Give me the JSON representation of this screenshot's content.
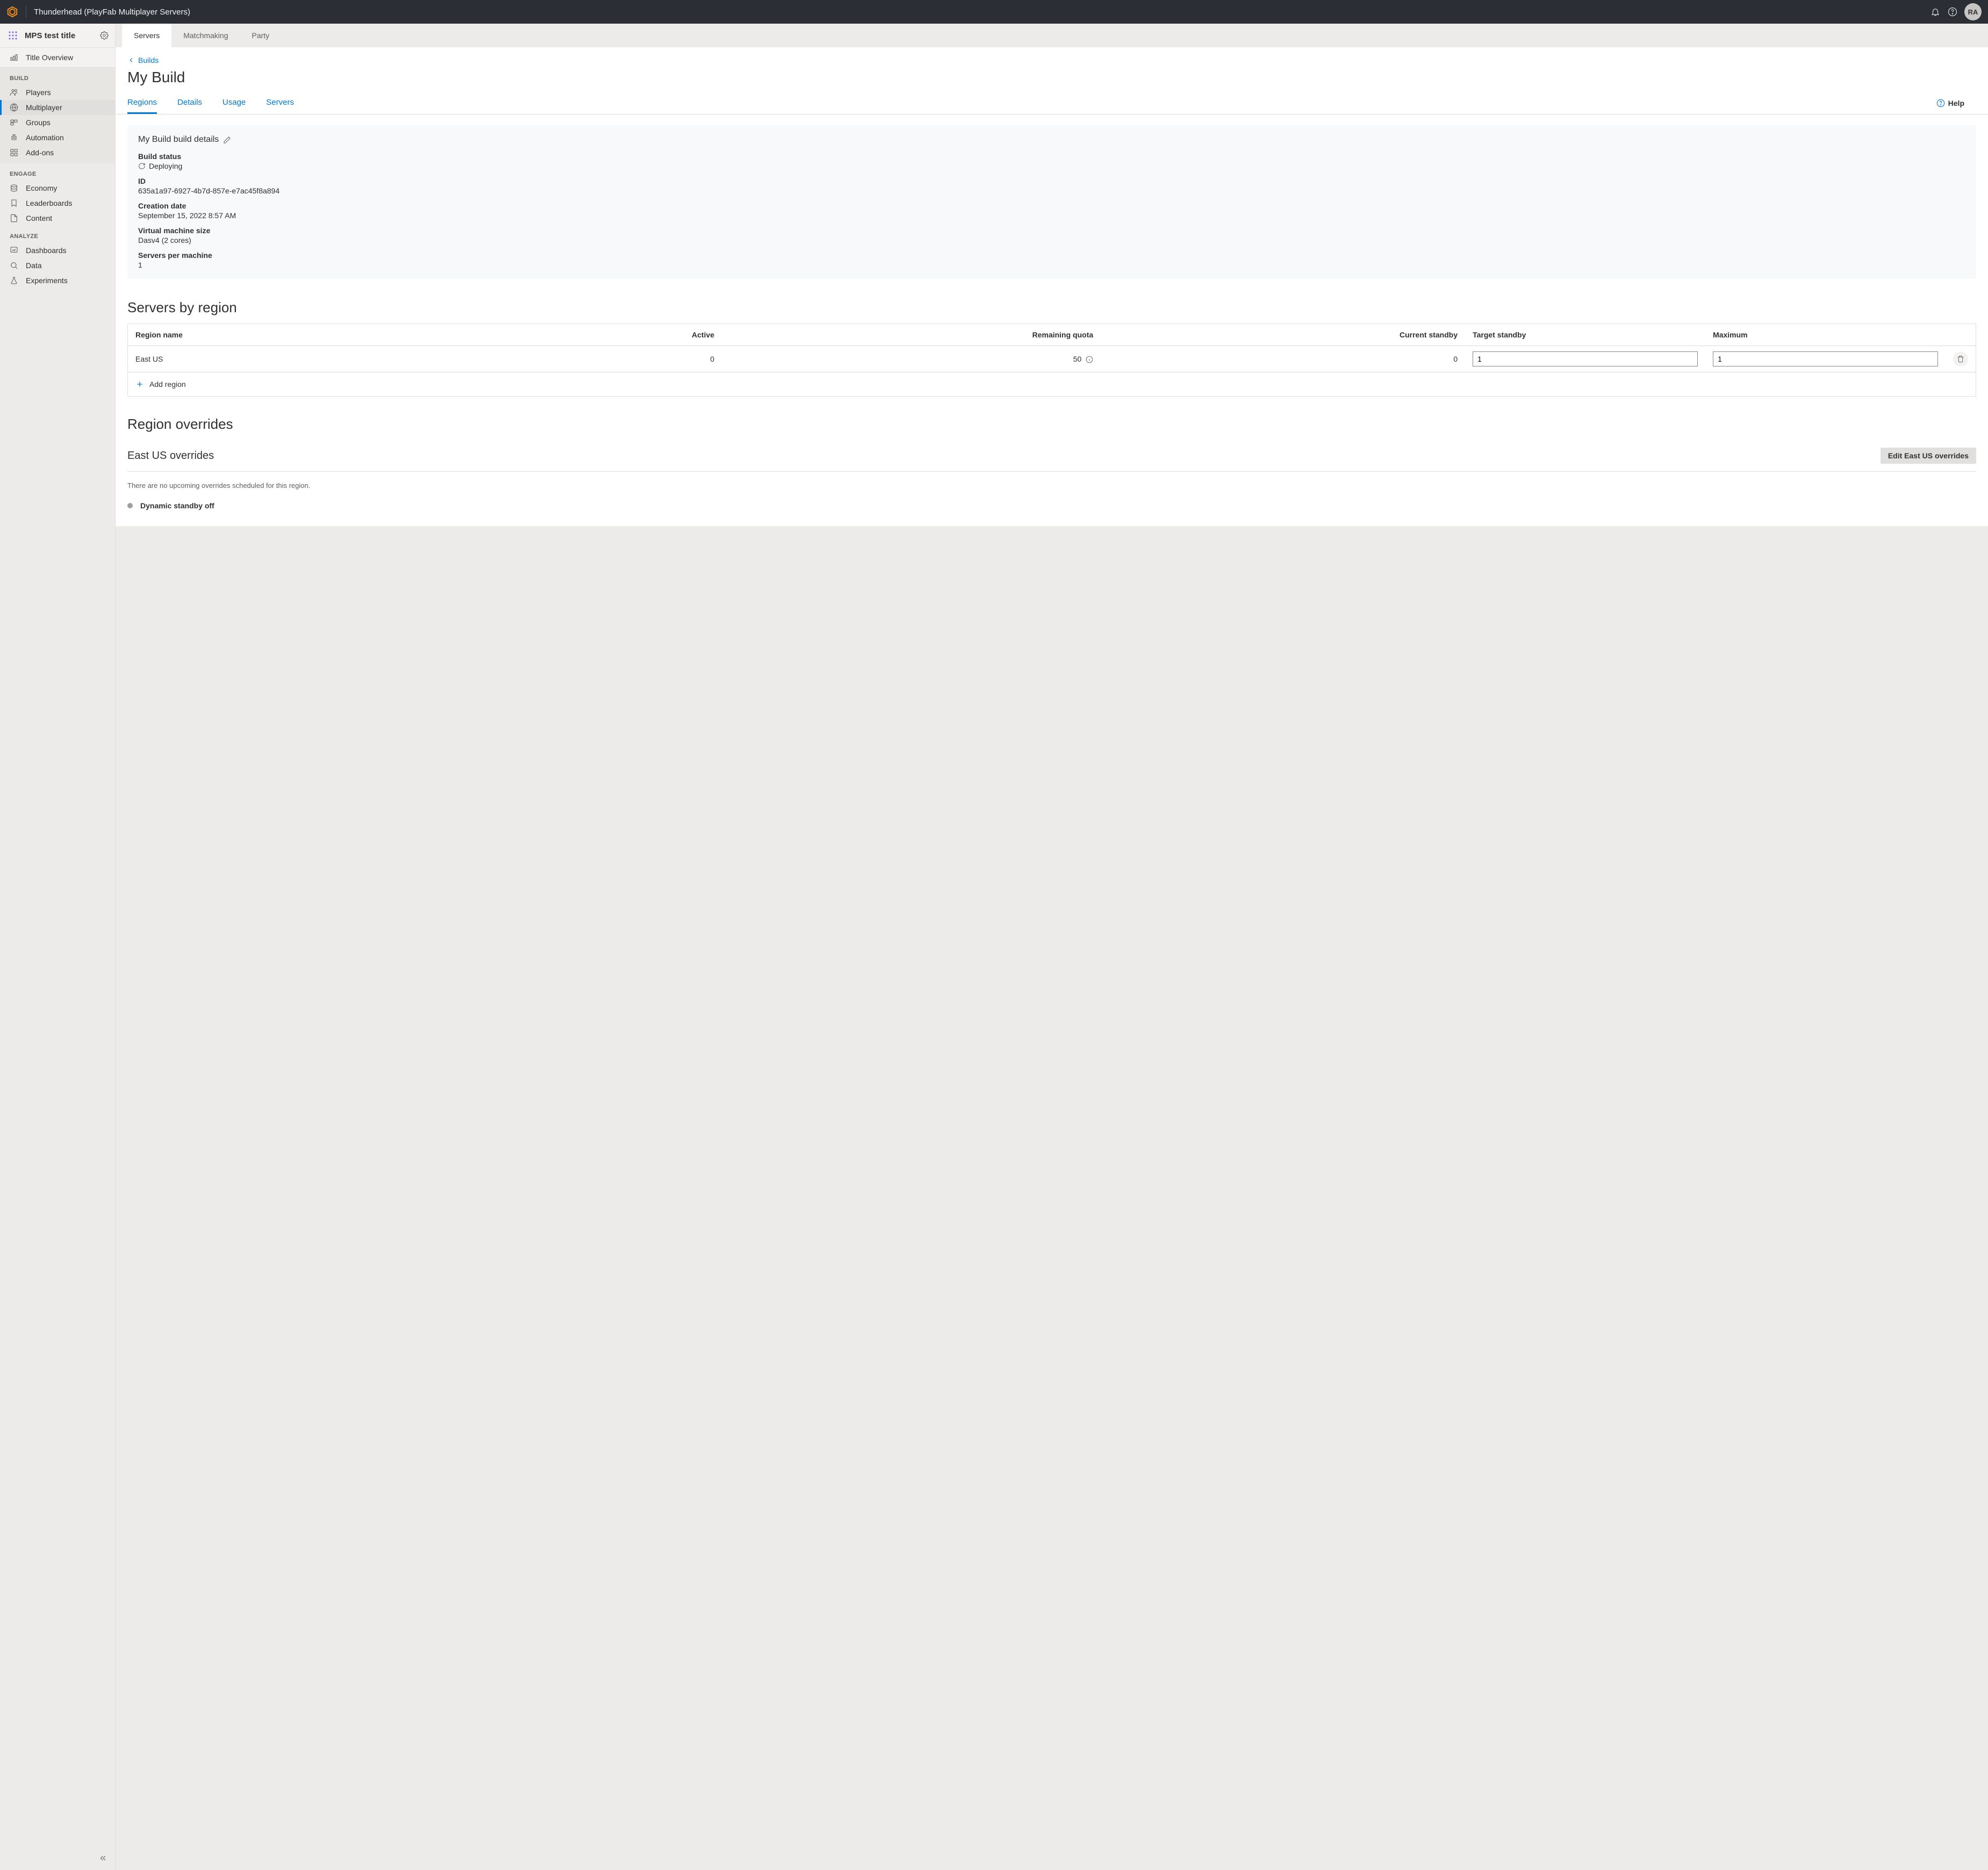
{
  "topbar": {
    "title": "Thunderhead (PlayFab Multiplayer Servers)",
    "avatar_initials": "RA"
  },
  "sidebar": {
    "title": "MPS test title",
    "overview_label": "Title Overview",
    "group_build": "BUILD",
    "build_items": {
      "players": "Players",
      "multiplayer": "Multiplayer",
      "groups": "Groups",
      "automation": "Automation",
      "addons": "Add-ons"
    },
    "group_engage": "ENGAGE",
    "engage_items": {
      "economy": "Economy",
      "leaderboards": "Leaderboards",
      "content": "Content"
    },
    "group_analyze": "ANALYZE",
    "analyze_items": {
      "dashboards": "Dashboards",
      "data": "Data",
      "experiments": "Experiments"
    }
  },
  "main_tabs": {
    "servers": "Servers",
    "matchmaking": "Matchmaking",
    "party": "Party"
  },
  "breadcrumb": {
    "label": "Builds"
  },
  "page_title": "My Build",
  "subtabs": {
    "regions": "Regions",
    "details": "Details",
    "usage": "Usage",
    "servers": "Servers"
  },
  "help_label": "Help",
  "build_details": {
    "heading": "My Build build details",
    "status_label": "Build status",
    "status_value": "Deploying",
    "id_label": "ID",
    "id_value": "635a1a97-6927-4b7d-857e-e7ac45f8a894",
    "created_label": "Creation date",
    "created_value": "September 15, 2022 8:57 AM",
    "vm_label": "Virtual machine size",
    "vm_value": "Dasv4 (2 cores)",
    "spm_label": "Servers per machine",
    "spm_value": "1"
  },
  "servers_by_region": {
    "heading": "Servers by region",
    "columns": {
      "region": "Region name",
      "active": "Active",
      "remaining_quota": "Remaining quota",
      "current_standby": "Current standby",
      "target_standby": "Target standby",
      "maximum": "Maximum"
    },
    "rows": [
      {
        "region": "East US",
        "active": "0",
        "remaining_quota": "50",
        "current_standby": "0",
        "target_standby": "1",
        "maximum": "1"
      }
    ],
    "add_region_label": "Add region"
  },
  "region_overrides": {
    "heading": "Region overrides",
    "sub_heading": "East US overrides",
    "edit_button": "Edit East US overrides",
    "empty_text": "There are no upcoming overrides scheduled for this region.",
    "dynamic_standby_label": "Dynamic standby off"
  }
}
